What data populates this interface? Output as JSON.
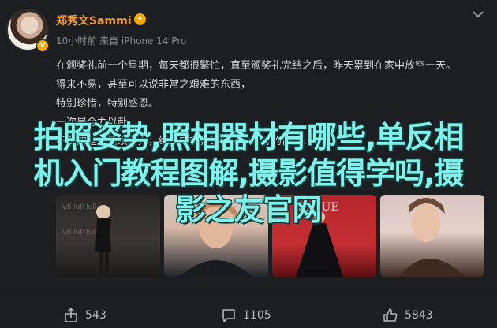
{
  "post": {
    "author": "郑秀文Sammi",
    "avatar_badge": "V",
    "meta": "10小时前 来自 iPhone 14 Pro",
    "paragraphs": [
      "在颁奖礼前一个星期，每天都很繁忙，直至颁奖礼完结之后，昨天累到在家中放空一天。",
      "得来不易，甚至可以说非常之艰难的东西，",
      "特别珍惜，特别感恩。",
      "一次是全力以赴，",
      "不变的是，继续努力，继续向前，继续成为更好的自己。"
    ]
  },
  "overlay_headline": [
    "拍照姿势,照相器材有哪些,单反相",
    "机入门教程图解,摄影值得学吗,摄",
    "影之友官网"
  ],
  "photos": [
    {
      "name": "photo-1"
    },
    {
      "name": "photo-2"
    },
    {
      "name": "photo-3"
    },
    {
      "name": "photo-4"
    }
  ],
  "actions": {
    "share_count": "543",
    "comment_count": "1105",
    "like_count": "5843"
  },
  "colors": {
    "background": "#1d1e21",
    "username": "#f0a030",
    "overlay_text": "#7ff2ec",
    "muted": "#8b8c90"
  },
  "icons": [
    "chevron-down-icon",
    "verified-icon",
    "share-icon",
    "comment-icon",
    "like-icon"
  ]
}
